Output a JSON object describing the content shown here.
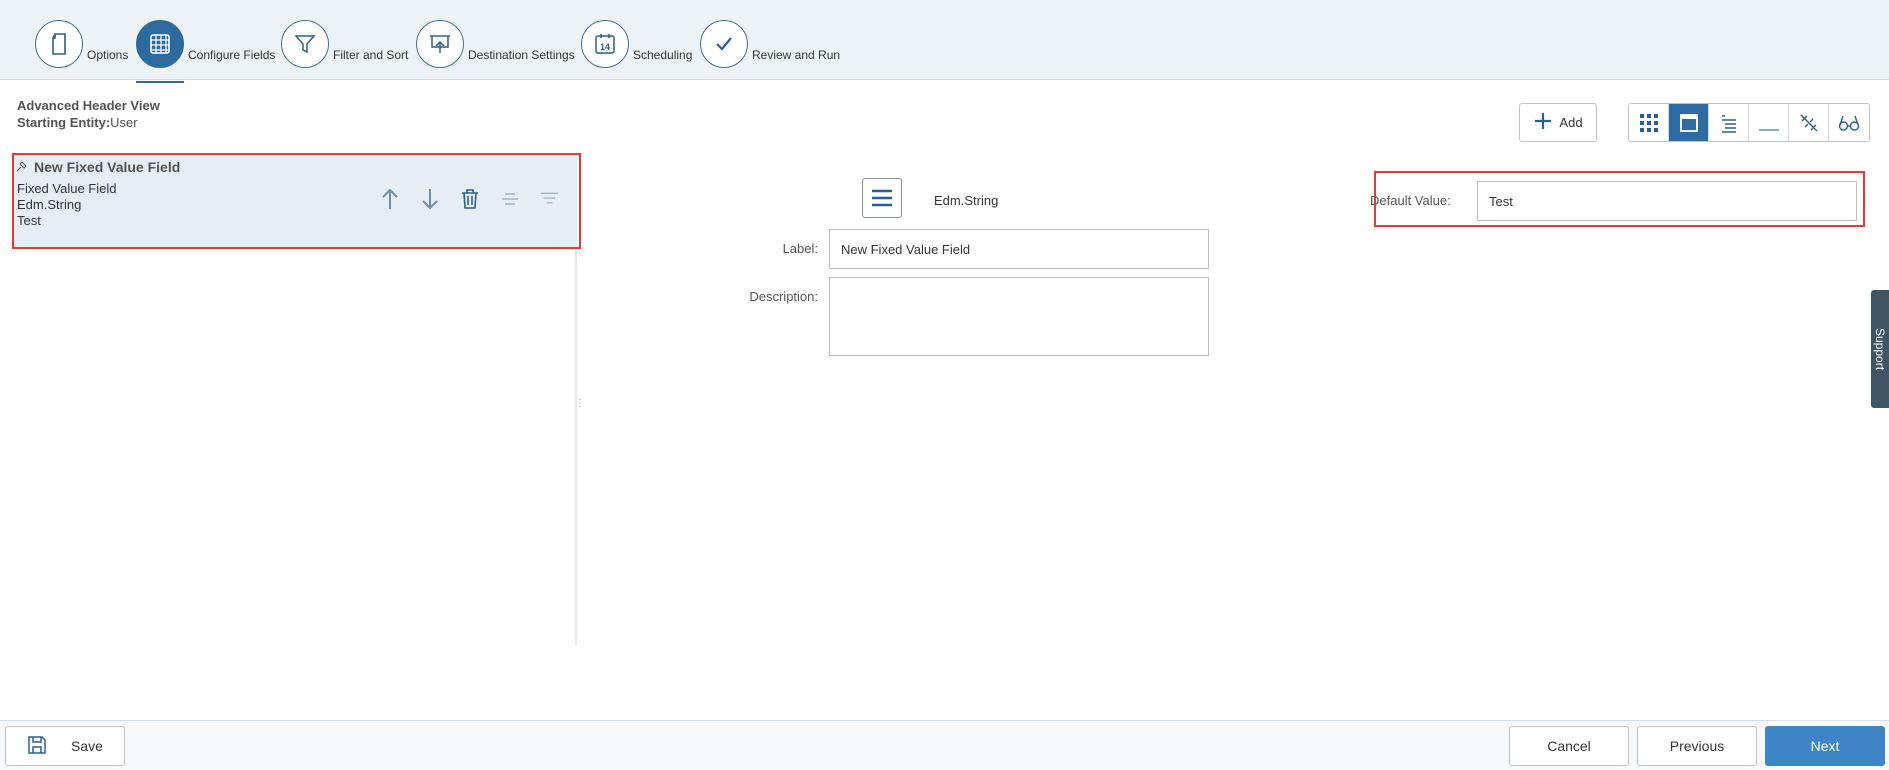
{
  "steps": [
    {
      "label": "Options",
      "icon": "document-icon"
    },
    {
      "label": "Configure Fields",
      "icon": "grid-icon"
    },
    {
      "label": "Filter and Sort",
      "icon": "filter-icon"
    },
    {
      "label": "Destination Settings",
      "icon": "presentation-icon"
    },
    {
      "label": "Scheduling",
      "icon": "calendar-icon",
      "icon_text": "14"
    },
    {
      "label": "Review and Run",
      "icon": "checkmark-icon"
    }
  ],
  "active_step": "Configure Fields",
  "header": {
    "title": "Advanced Header View",
    "entity_label": "Starting Entity:",
    "entity_value": "User"
  },
  "toolbar": {
    "add_label": "Add",
    "view_buttons": [
      "grid-view-icon",
      "panel-view-icon",
      "list-view-icon",
      "line-view-icon",
      "unlink-icon",
      "glasses-icon"
    ],
    "selected_view": "panel-view-icon"
  },
  "field_card": {
    "title": "New Fixed Value Field",
    "type_name": "Fixed Value Field",
    "data_type": "Edm.String",
    "value": "Test"
  },
  "detail": {
    "data_type": "Edm.String",
    "label_caption": "Label:",
    "label_value": "New Fixed Value Field",
    "description_caption": "Description:",
    "description_value": "",
    "default_value_caption": "Default Value:",
    "default_value": "Test"
  },
  "support_tab": "Support",
  "footer": {
    "save": "Save",
    "cancel": "Cancel",
    "previous": "Previous",
    "next": "Next"
  },
  "colors": {
    "accent": "#2d6a9f",
    "highlight": "#e53935",
    "primary_button": "#3d85c6"
  }
}
